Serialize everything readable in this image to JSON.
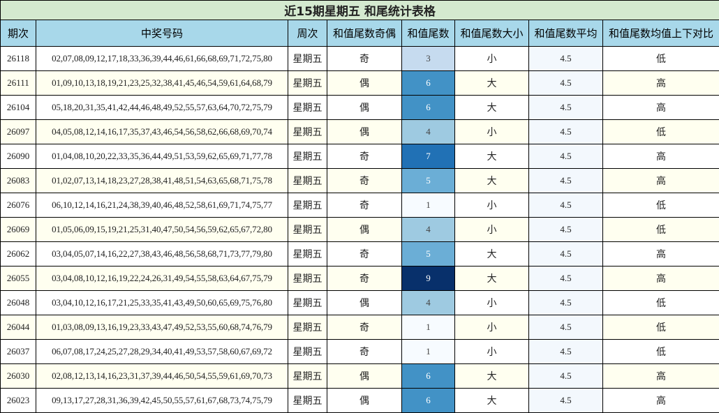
{
  "title": "近15期星期五 和尾统计表格",
  "headers": [
    "期次",
    "中奖号码",
    "周次",
    "和值尾数奇偶",
    "和值尾数",
    "和值尾数大小",
    "和值尾数平均",
    "和值尾数均值上下对比"
  ],
  "rows": [
    {
      "issue": "26118",
      "numbers": "02,07,08,09,12,17,18,33,36,39,44,46,61,66,68,69,71,72,75,80",
      "weekday": "星期五",
      "parity": "奇",
      "tail": "3",
      "size": "小",
      "avg": "4.5",
      "compare": "低",
      "tail_color": "#c6dbef",
      "tail_text_color": "#444444"
    },
    {
      "issue": "26111",
      "numbers": "01,09,10,13,18,19,21,23,25,32,38,41,45,46,54,59,61,64,68,79",
      "weekday": "星期五",
      "parity": "偶",
      "tail": "6",
      "size": "大",
      "avg": "4.5",
      "compare": "高",
      "tail_color": "#4292c6",
      "tail_text_color": "#ffffff"
    },
    {
      "issue": "26104",
      "numbers": "05,18,20,31,35,41,42,44,46,48,49,52,55,57,63,64,70,72,75,79",
      "weekday": "星期五",
      "parity": "偶",
      "tail": "6",
      "size": "大",
      "avg": "4.5",
      "compare": "高",
      "tail_color": "#4292c6",
      "tail_text_color": "#ffffff"
    },
    {
      "issue": "26097",
      "numbers": "04,05,08,12,14,16,17,35,37,43,46,54,56,58,62,66,68,69,70,74",
      "weekday": "星期五",
      "parity": "偶",
      "tail": "4",
      "size": "小",
      "avg": "4.5",
      "compare": "低",
      "tail_color": "#9ecae1",
      "tail_text_color": "#444444"
    },
    {
      "issue": "26090",
      "numbers": "01,04,08,10,20,22,33,35,36,44,49,51,53,59,62,65,69,71,77,78",
      "weekday": "星期五",
      "parity": "奇",
      "tail": "7",
      "size": "大",
      "avg": "4.5",
      "compare": "高",
      "tail_color": "#2171b5",
      "tail_text_color": "#ffffff"
    },
    {
      "issue": "26083",
      "numbers": "01,02,07,13,14,18,23,27,28,38,41,48,51,54,63,65,68,71,75,78",
      "weekday": "星期五",
      "parity": "奇",
      "tail": "5",
      "size": "大",
      "avg": "4.5",
      "compare": "高",
      "tail_color": "#6baed6",
      "tail_text_color": "#ffffff"
    },
    {
      "issue": "26076",
      "numbers": "06,10,12,14,16,21,24,38,39,40,46,48,52,58,61,69,71,74,75,77",
      "weekday": "星期五",
      "parity": "奇",
      "tail": "1",
      "size": "小",
      "avg": "4.5",
      "compare": "低",
      "tail_color": "#f7fbff",
      "tail_text_color": "#444444"
    },
    {
      "issue": "26069",
      "numbers": "01,05,06,09,15,19,21,25,31,40,47,50,54,56,59,62,65,67,72,80",
      "weekday": "星期五",
      "parity": "偶",
      "tail": "4",
      "size": "小",
      "avg": "4.5",
      "compare": "低",
      "tail_color": "#9ecae1",
      "tail_text_color": "#444444"
    },
    {
      "issue": "26062",
      "numbers": "03,04,05,07,14,16,22,27,38,43,46,48,56,58,68,71,73,77,79,80",
      "weekday": "星期五",
      "parity": "奇",
      "tail": "5",
      "size": "大",
      "avg": "4.5",
      "compare": "高",
      "tail_color": "#6baed6",
      "tail_text_color": "#ffffff"
    },
    {
      "issue": "26055",
      "numbers": "03,04,08,10,12,16,19,22,24,26,31,49,54,55,58,63,64,67,75,79",
      "weekday": "星期五",
      "parity": "奇",
      "tail": "9",
      "size": "大",
      "avg": "4.5",
      "compare": "高",
      "tail_color": "#08306b",
      "tail_text_color": "#ffffff"
    },
    {
      "issue": "26048",
      "numbers": "03,04,10,12,16,17,21,25,33,35,41,43,49,50,60,65,69,75,76,80",
      "weekday": "星期五",
      "parity": "偶",
      "tail": "4",
      "size": "小",
      "avg": "4.5",
      "compare": "低",
      "tail_color": "#9ecae1",
      "tail_text_color": "#444444"
    },
    {
      "issue": "26044",
      "numbers": "01,03,08,09,13,16,19,23,33,43,47,49,52,53,55,60,68,74,76,79",
      "weekday": "星期五",
      "parity": "奇",
      "tail": "1",
      "size": "小",
      "avg": "4.5",
      "compare": "低",
      "tail_color": "#f7fbff",
      "tail_text_color": "#444444"
    },
    {
      "issue": "26037",
      "numbers": "06,07,08,17,24,25,27,28,29,34,40,41,49,53,57,58,60,67,69,72",
      "weekday": "星期五",
      "parity": "奇",
      "tail": "1",
      "size": "小",
      "avg": "4.5",
      "compare": "低",
      "tail_color": "#f7fbff",
      "tail_text_color": "#444444"
    },
    {
      "issue": "26030",
      "numbers": "02,08,12,13,14,16,23,31,37,39,44,46,50,54,55,59,61,69,70,73",
      "weekday": "星期五",
      "parity": "偶",
      "tail": "6",
      "size": "大",
      "avg": "4.5",
      "compare": "高",
      "tail_color": "#4292c6",
      "tail_text_color": "#ffffff"
    },
    {
      "issue": "26023",
      "numbers": "09,13,17,27,28,31,36,39,42,45,50,55,57,61,67,68,73,74,75,79",
      "weekday": "星期五",
      "parity": "偶",
      "tail": "6",
      "size": "大",
      "avg": "4.5",
      "compare": "高",
      "tail_color": "#4292c6",
      "tail_text_color": "#ffffff"
    }
  ]
}
